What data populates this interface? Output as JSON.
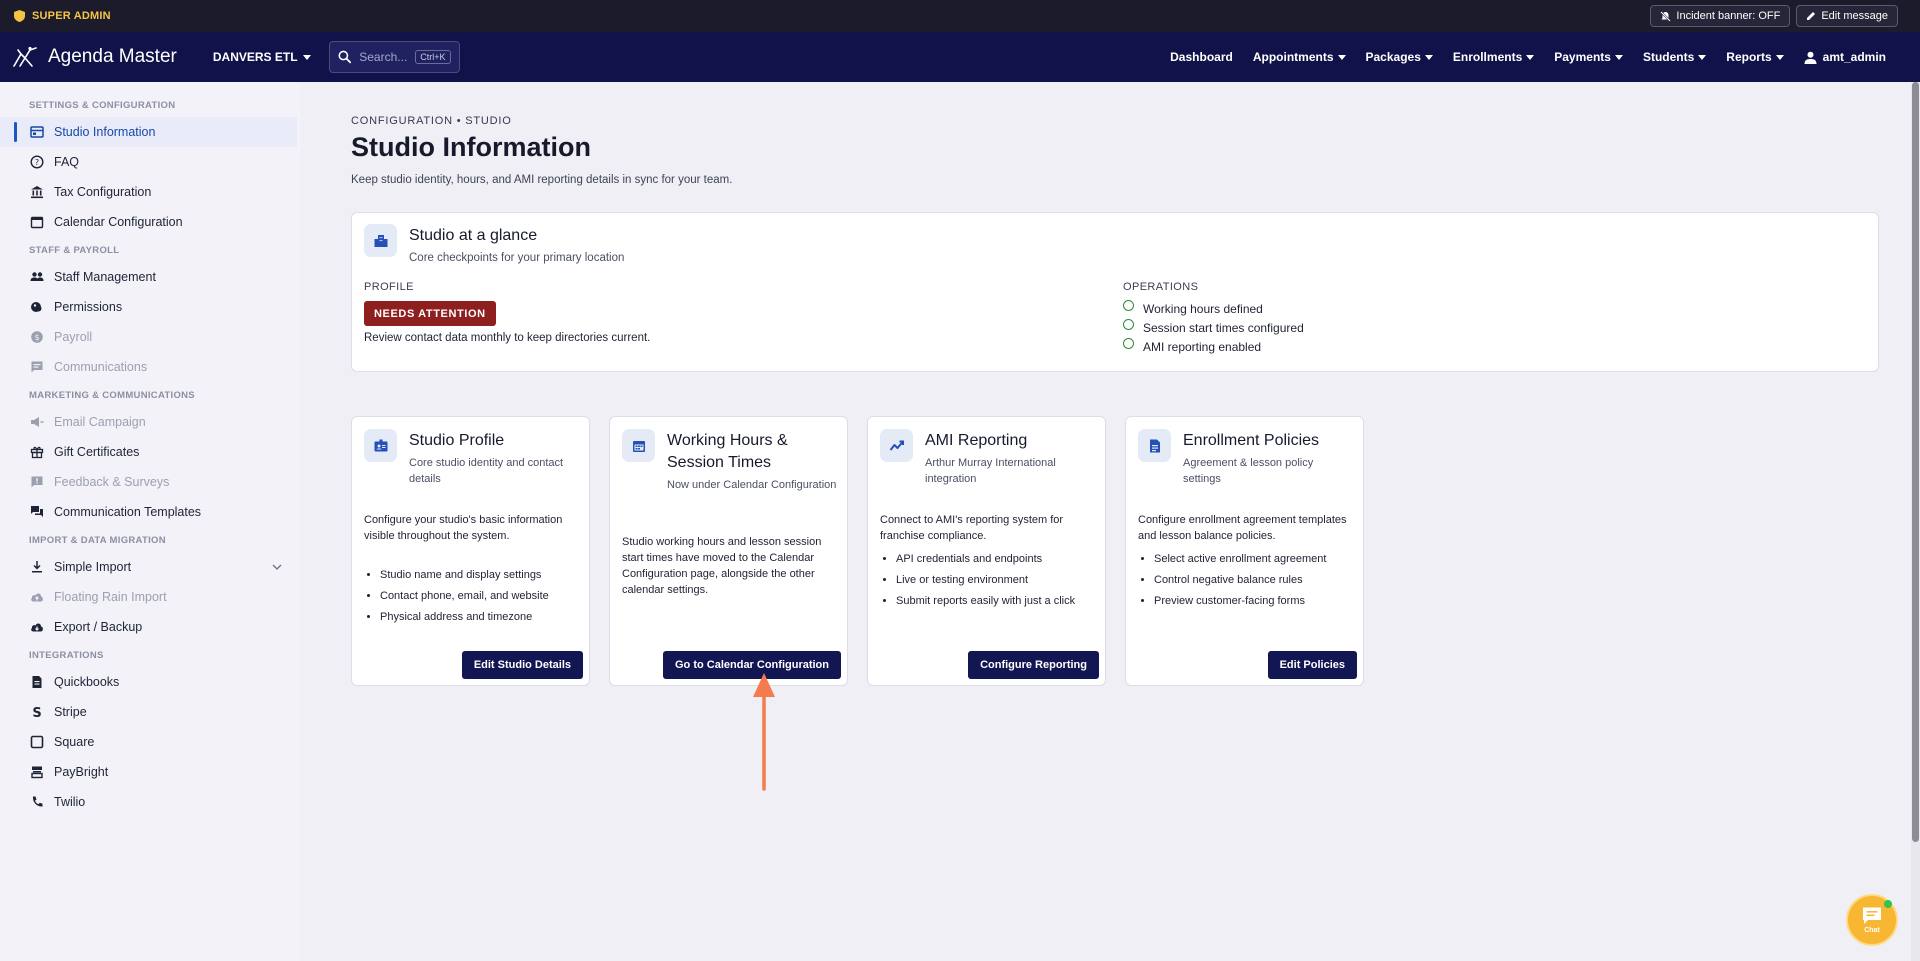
{
  "admin_bar": {
    "badge": "SUPER ADMIN",
    "incident_banner": "Incident banner: OFF",
    "edit_message": "Edit message"
  },
  "topnav": {
    "brand": "Agenda Master",
    "studio": "DANVERS ETL",
    "search_placeholder": "Search...",
    "search_shortcut": "Ctrl+K",
    "links": [
      "Dashboard",
      "Appointments",
      "Packages",
      "Enrollments",
      "Payments",
      "Students",
      "Reports"
    ],
    "user": "amt_admin"
  },
  "sidebar": {
    "sections": [
      {
        "title": "SETTINGS & CONFIGURATION",
        "items": [
          {
            "label": "Studio Information",
            "icon": "storefront-icon",
            "active": true
          },
          {
            "label": "FAQ",
            "icon": "help-circle-icon"
          },
          {
            "label": "Tax Configuration",
            "icon": "bank-icon"
          },
          {
            "label": "Calendar Configuration",
            "icon": "calendar-icon"
          }
        ]
      },
      {
        "title": "STAFF & PAYROLL",
        "items": [
          {
            "label": "Staff Management",
            "icon": "people-icon"
          },
          {
            "label": "Permissions",
            "icon": "key-icon"
          },
          {
            "label": "Payroll",
            "icon": "payments-icon",
            "disabled": true
          },
          {
            "label": "Communications",
            "icon": "chat-icon",
            "disabled": true
          }
        ]
      },
      {
        "title": "MARKETING & COMMUNICATIONS",
        "items": [
          {
            "label": "Email Campaign",
            "icon": "campaign-icon",
            "disabled": true
          },
          {
            "label": "Gift Certificates",
            "icon": "gift-icon"
          },
          {
            "label": "Feedback & Surveys",
            "icon": "feedback-icon",
            "disabled": true
          },
          {
            "label": "Communication Templates",
            "icon": "forum-icon"
          }
        ]
      },
      {
        "title": "IMPORT & DATA MIGRATION",
        "items": [
          {
            "label": "Simple Import",
            "icon": "download-icon",
            "expandable": true
          },
          {
            "label": "Floating Rain Import",
            "icon": "cloud-upload-icon",
            "disabled": true
          },
          {
            "label": "Export / Backup",
            "icon": "cloud-download-icon"
          }
        ]
      },
      {
        "title": "INTEGRATIONS",
        "items": [
          {
            "label": "Quickbooks",
            "icon": "document-icon"
          },
          {
            "label": "Stripe",
            "icon": "stripe-icon"
          },
          {
            "label": "Square",
            "icon": "square-icon"
          },
          {
            "label": "PayBright",
            "icon": "paybright-icon"
          },
          {
            "label": "Twilio",
            "icon": "phone-icon"
          }
        ]
      }
    ]
  },
  "page": {
    "breadcrumb": "CONFIGURATION • STUDIO",
    "title": "Studio Information",
    "subtitle": "Keep studio identity, hours, and AMI reporting details in sync for your team."
  },
  "glance": {
    "title": "Studio at a glance",
    "subtitle": "Core checkpoints for your primary location",
    "profile_label": "PROFILE",
    "status": "NEEDS ATTENTION",
    "note": "Review contact data monthly to keep directories current.",
    "operations_label": "OPERATIONS",
    "operations": [
      "Working hours defined",
      "Session start times configured",
      "AMI reporting enabled"
    ]
  },
  "cards": [
    {
      "title": "Studio Profile",
      "subtitle": "Core studio identity and contact details",
      "body": "Configure your studio's basic information visible throughout the system.",
      "bullets": [
        "Studio name and display settings",
        "Contact phone, email, and website",
        "Physical address and timezone"
      ],
      "button": "Edit Studio Details"
    },
    {
      "title": "Working Hours & Session Times",
      "subtitle": "Now under Calendar Configuration",
      "body": "Studio working hours and lesson session start times have moved to the Calendar Configuration page, alongside the other calendar settings.",
      "bullets": [],
      "button": "Go to Calendar Configuration"
    },
    {
      "title": "AMI Reporting",
      "subtitle": "Arthur Murray International integration",
      "body": "Connect to AMI's reporting system for franchise compliance.",
      "bullets": [
        "API credentials and endpoints",
        "Live or testing environment",
        "Submit reports easily with just a click"
      ],
      "button": "Configure Reporting"
    },
    {
      "title": "Enrollment Policies",
      "subtitle": "Agreement & lesson policy settings",
      "body": "Configure enrollment agreement templates and lesson balance policies.",
      "bullets": [
        "Select active enrollment agreement",
        "Control negative balance rules",
        "Preview customer-facing forms"
      ],
      "button": "Edit Policies"
    }
  ],
  "chat": {
    "label": "Chat"
  },
  "colors": {
    "nav": "#11124a",
    "accent": "#1d55c9",
    "button": "#121652",
    "attention": "#8e1f1f",
    "annotation_arrow": "#f47b4d",
    "chat": "#f8b733"
  }
}
